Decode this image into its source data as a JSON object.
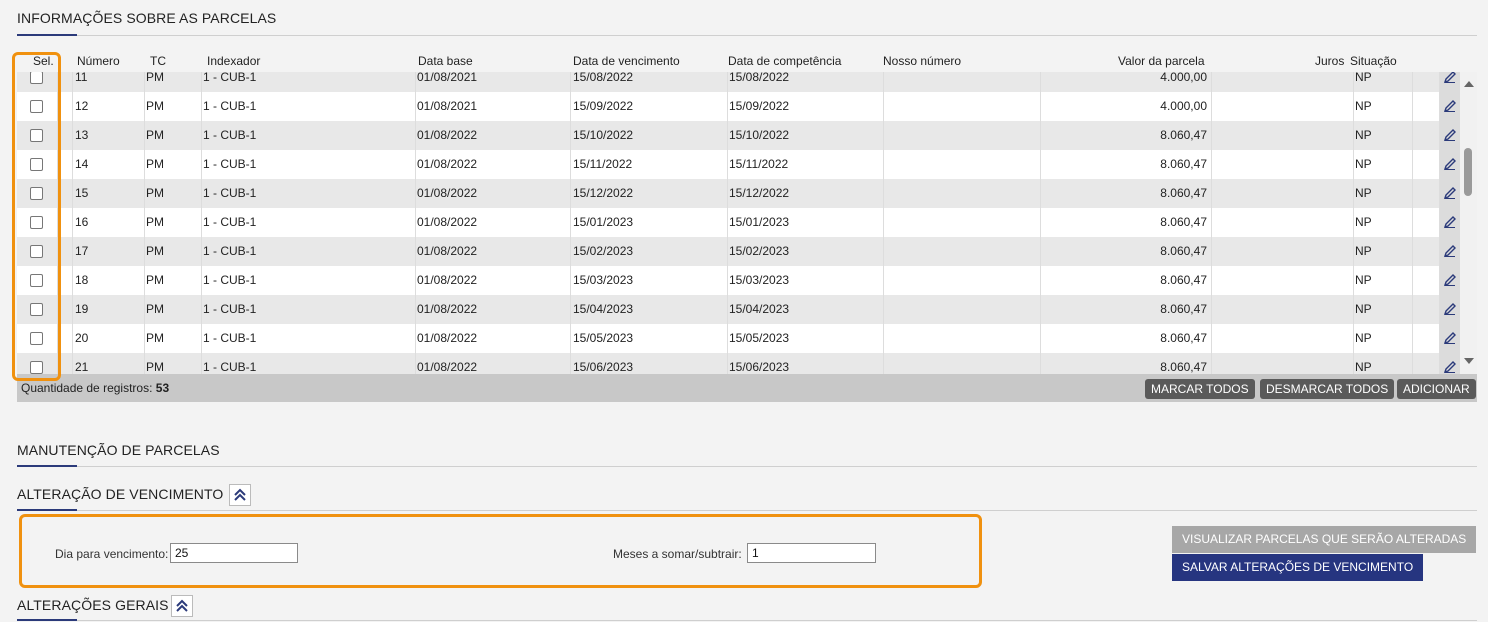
{
  "installments_section": {
    "title": "INFORMAÇÕES SOBRE AS PARCELAS"
  },
  "grid": {
    "columns": {
      "sel": "Sel.",
      "numero": "Número",
      "tc": "TC",
      "indexador": "Indexador",
      "data_base": "Data base",
      "data_vencimento": "Data de vencimento",
      "data_competencia": "Data de competência",
      "nosso_numero": "Nosso número",
      "valor": "Valor da parcela",
      "juros": "Juros",
      "situacao": "Situação"
    },
    "rows": [
      {
        "numero": "11",
        "tc": "PM",
        "indexador": "1 - CUB-1",
        "data_base": "01/08/2021",
        "vencimento": "15/08/2022",
        "competencia": "15/08/2022",
        "nosso_numero": "",
        "valor": "4.000,00",
        "juros": "",
        "situacao": "NP"
      },
      {
        "numero": "12",
        "tc": "PM",
        "indexador": "1 - CUB-1",
        "data_base": "01/08/2021",
        "vencimento": "15/09/2022",
        "competencia": "15/09/2022",
        "nosso_numero": "",
        "valor": "4.000,00",
        "juros": "",
        "situacao": "NP"
      },
      {
        "numero": "13",
        "tc": "PM",
        "indexador": "1 - CUB-1",
        "data_base": "01/08/2022",
        "vencimento": "15/10/2022",
        "competencia": "15/10/2022",
        "nosso_numero": "",
        "valor": "8.060,47",
        "juros": "",
        "situacao": "NP"
      },
      {
        "numero": "14",
        "tc": "PM",
        "indexador": "1 - CUB-1",
        "data_base": "01/08/2022",
        "vencimento": "15/11/2022",
        "competencia": "15/11/2022",
        "nosso_numero": "",
        "valor": "8.060,47",
        "juros": "",
        "situacao": "NP"
      },
      {
        "numero": "15",
        "tc": "PM",
        "indexador": "1 - CUB-1",
        "data_base": "01/08/2022",
        "vencimento": "15/12/2022",
        "competencia": "15/12/2022",
        "nosso_numero": "",
        "valor": "8.060,47",
        "juros": "",
        "situacao": "NP"
      },
      {
        "numero": "16",
        "tc": "PM",
        "indexador": "1 - CUB-1",
        "data_base": "01/08/2022",
        "vencimento": "15/01/2023",
        "competencia": "15/01/2023",
        "nosso_numero": "",
        "valor": "8.060,47",
        "juros": "",
        "situacao": "NP"
      },
      {
        "numero": "17",
        "tc": "PM",
        "indexador": "1 - CUB-1",
        "data_base": "01/08/2022",
        "vencimento": "15/02/2023",
        "competencia": "15/02/2023",
        "nosso_numero": "",
        "valor": "8.060,47",
        "juros": "",
        "situacao": "NP"
      },
      {
        "numero": "18",
        "tc": "PM",
        "indexador": "1 - CUB-1",
        "data_base": "01/08/2022",
        "vencimento": "15/03/2023",
        "competencia": "15/03/2023",
        "nosso_numero": "",
        "valor": "8.060,47",
        "juros": "",
        "situacao": "NP"
      },
      {
        "numero": "19",
        "tc": "PM",
        "indexador": "1 - CUB-1",
        "data_base": "01/08/2022",
        "vencimento": "15/04/2023",
        "competencia": "15/04/2023",
        "nosso_numero": "",
        "valor": "8.060,47",
        "juros": "",
        "situacao": "NP"
      },
      {
        "numero": "20",
        "tc": "PM",
        "indexador": "1 - CUB-1",
        "data_base": "01/08/2022",
        "vencimento": "15/05/2023",
        "competencia": "15/05/2023",
        "nosso_numero": "",
        "valor": "8.060,47",
        "juros": "",
        "situacao": "NP"
      },
      {
        "numero": "21",
        "tc": "PM",
        "indexador": "1 - CUB-1",
        "data_base": "01/08/2022",
        "vencimento": "15/06/2023",
        "competencia": "15/06/2023",
        "nosso_numero": "",
        "valor": "8.060,47",
        "juros": "",
        "situacao": "NP"
      }
    ],
    "footer": {
      "count_label": "Quantidade de registros:",
      "count_value": "53",
      "mark_all": "MARCAR TODOS",
      "unmark_all": "DESMARCAR TODOS",
      "add": "ADICIONAR"
    }
  },
  "maintenance_section": {
    "title": "MANUTENÇÃO DE PARCELAS"
  },
  "due_change": {
    "title": "ALTERAÇÃO DE VENCIMENTO",
    "day_label": "Dia para vencimento:",
    "day_value": "25",
    "months_label": "Meses a somar/subtrair:",
    "months_value": "1",
    "preview_button": "VISUALIZAR PARCELAS QUE SERÃO ALTERADAS",
    "save_button": "SALVAR ALTERAÇÕES DE VENCIMENTO"
  },
  "general_changes": {
    "title": "ALTERAÇÕES GERAIS"
  },
  "colors": {
    "accent": "#2b3a7a",
    "highlight": "#f0910f",
    "save_button": "#263580"
  }
}
